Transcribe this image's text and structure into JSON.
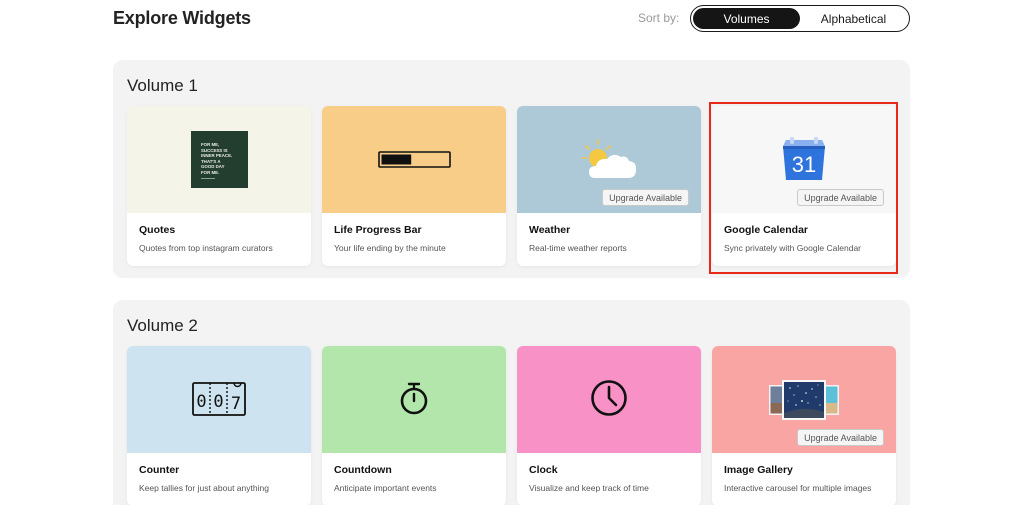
{
  "header": {
    "title": "Explore Widgets",
    "sort_label": "Sort by:",
    "sort_options": [
      "Volumes",
      "Alphabetical"
    ],
    "sort_selected": "Volumes"
  },
  "volumes": [
    {
      "title": "Volume 1",
      "cards": [
        {
          "name": "Quotes",
          "desc": "Quotes from top instagram curators",
          "thumb_color": "#f5f4e8",
          "icon": "quote-poster-icon",
          "quote_text": [
            "FOR ME,",
            "SUCCESS IS",
            "INNER PEACE.",
            "THAT'S A",
            "GOOD DAY",
            "FOR ME."
          ]
        },
        {
          "name": "Life Progress Bar",
          "desc": "Your life ending by the minute",
          "thumb_color": "#f7cd88",
          "icon": "progress-bar-icon",
          "progress": 0.45
        },
        {
          "name": "Weather",
          "desc": "Real-time weather reports",
          "thumb_color": "#adc8d7",
          "icon": "sun-cloud-icon",
          "badge": "Upgrade Available"
        },
        {
          "name": "Google Calendar",
          "desc": "Sync privately with Google Calendar",
          "thumb_color": "#f7f7f7",
          "icon": "google-calendar-icon",
          "icon_text": "31",
          "badge": "Upgrade Available"
        }
      ]
    },
    {
      "title": "Volume 2",
      "cards": [
        {
          "name": "Counter",
          "desc": "Keep tallies for just about anything",
          "thumb_color": "#cde3f0",
          "icon": "counter-icon",
          "digits": [
            "0",
            "0",
            "7"
          ]
        },
        {
          "name": "Countdown",
          "desc": "Anticipate important events",
          "thumb_color": "#b2e6aa",
          "icon": "stopwatch-icon"
        },
        {
          "name": "Clock",
          "desc": "Visualize and keep track of time",
          "thumb_color": "#f892c6",
          "icon": "clock-icon"
        },
        {
          "name": "Image Gallery",
          "desc": "Interactive carousel for multiple images",
          "thumb_color": "#f9a5a3",
          "icon": "image-gallery-icon",
          "badge": "Upgrade Available"
        }
      ]
    }
  ],
  "colors": {
    "highlight": "#e8291a",
    "toggle_active": "#151515",
    "panel": "#f3f3f3"
  }
}
